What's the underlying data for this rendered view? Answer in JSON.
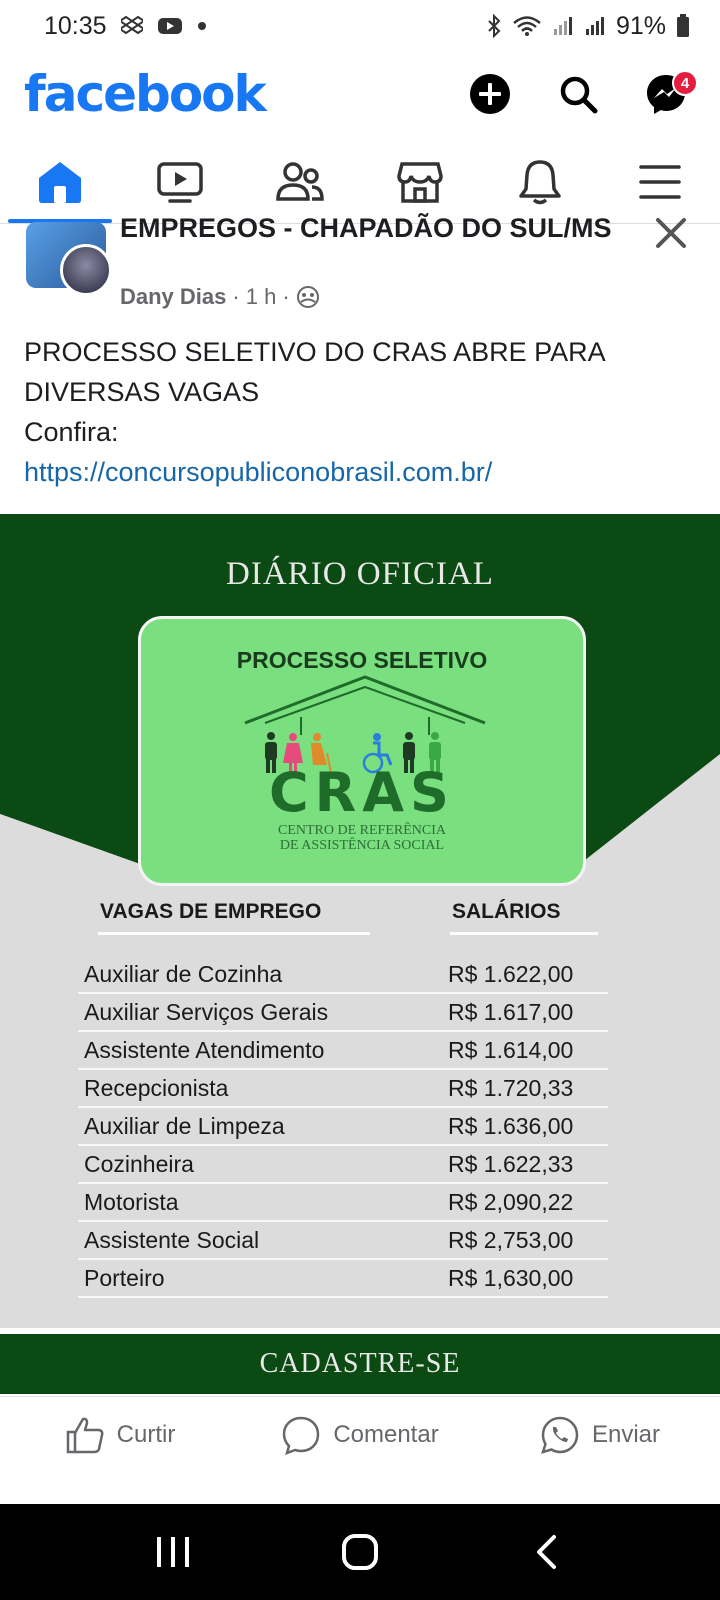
{
  "status_bar": {
    "time": "10:35",
    "battery": "91%"
  },
  "header": {
    "logo": "facebook",
    "messenger_badge": "4",
    "icons": [
      "add-icon",
      "search-icon",
      "messenger-icon"
    ]
  },
  "tabs": [
    {
      "name": "home",
      "icon": "home-icon",
      "active": true
    },
    {
      "name": "watch",
      "icon": "video-icon"
    },
    {
      "name": "friends",
      "icon": "friends-icon"
    },
    {
      "name": "marketplace",
      "icon": "marketplace-icon"
    },
    {
      "name": "notifications",
      "icon": "bell-icon"
    },
    {
      "name": "menu",
      "icon": "menu-icon"
    }
  ],
  "post": {
    "group_name": "EMPREGOS - CHAPADÃO DO SUL/MS",
    "author": "Dany Dias",
    "time": "1 h",
    "text_line1": "PROCESSO SELETIVO DO CRAS ABRE PARA DIVERSAS VAGAS",
    "text_line2": "Confira:",
    "link": "https://concursopubliconobrasil.com.br/"
  },
  "image": {
    "header": "DIÁRIO OFICIAL",
    "card_title": "PROCESSO SELETIVO",
    "logo_word": "CRAS",
    "logo_sub1": "CENTRO DE REFERÊNCIA",
    "logo_sub2": "DE ASSISTÊNCIA SOCIAL",
    "col_jobs": "VAGAS DE EMPREGO",
    "col_salaries": "SALÁRIOS",
    "rows": [
      {
        "job": "Auxiliar de Cozinha",
        "salary": "R$ 1.622,00"
      },
      {
        "job": "Auxiliar Serviços Gerais",
        "salary": "R$ 1.617,00"
      },
      {
        "job": "Assistente Atendimento",
        "salary": "R$ 1.614,00"
      },
      {
        "job": "Recepcionista",
        "salary": "R$ 1.720,33"
      },
      {
        "job": "Auxiliar de Limpeza",
        "salary": "R$ 1.636,00"
      },
      {
        "job": "Cozinheira",
        "salary": "R$ 1.622,33"
      },
      {
        "job": "Motorista",
        "salary": "R$ 2,090,22"
      },
      {
        "job": "Assistente Social",
        "salary": "R$ 2,753,00"
      },
      {
        "job": "Porteiro",
        "salary": "R$ 1,630,00"
      }
    ],
    "footer": "CADASTRE-SE"
  },
  "actions": {
    "like": "Curtir",
    "comment": "Comentar",
    "share": "Enviar"
  },
  "colors": {
    "brand": "#1877f2",
    "dark_green": "#0b4a12",
    "card_green": "#79df7f"
  }
}
